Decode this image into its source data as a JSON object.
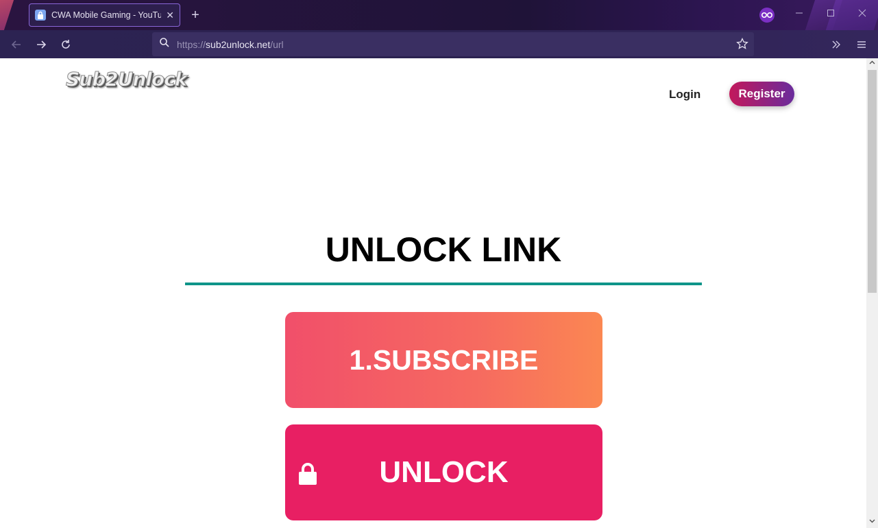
{
  "browser": {
    "tab_title": "CWA Mobile Gaming - YouTube",
    "tab_close": "✕",
    "new_tab": "+",
    "url_scheme": "https://",
    "url_host": "sub2unlock.net",
    "url_path": "/url"
  },
  "page": {
    "logo_text": "Sub2Unlock",
    "login_label": "Login",
    "register_label": "Register",
    "heading": "UNLOCK LINK",
    "subscribe_label": "1.SUBSCRIBE",
    "unlock_label": "UNLOCK"
  },
  "colors": {
    "divider": "#0e9489",
    "unlock_button": "#e81f63",
    "subscribe_gradient": [
      "#f14f6a",
      "#fb8752"
    ],
    "register_gradient": [
      "#c2185b",
      "#6a2c9c"
    ]
  }
}
